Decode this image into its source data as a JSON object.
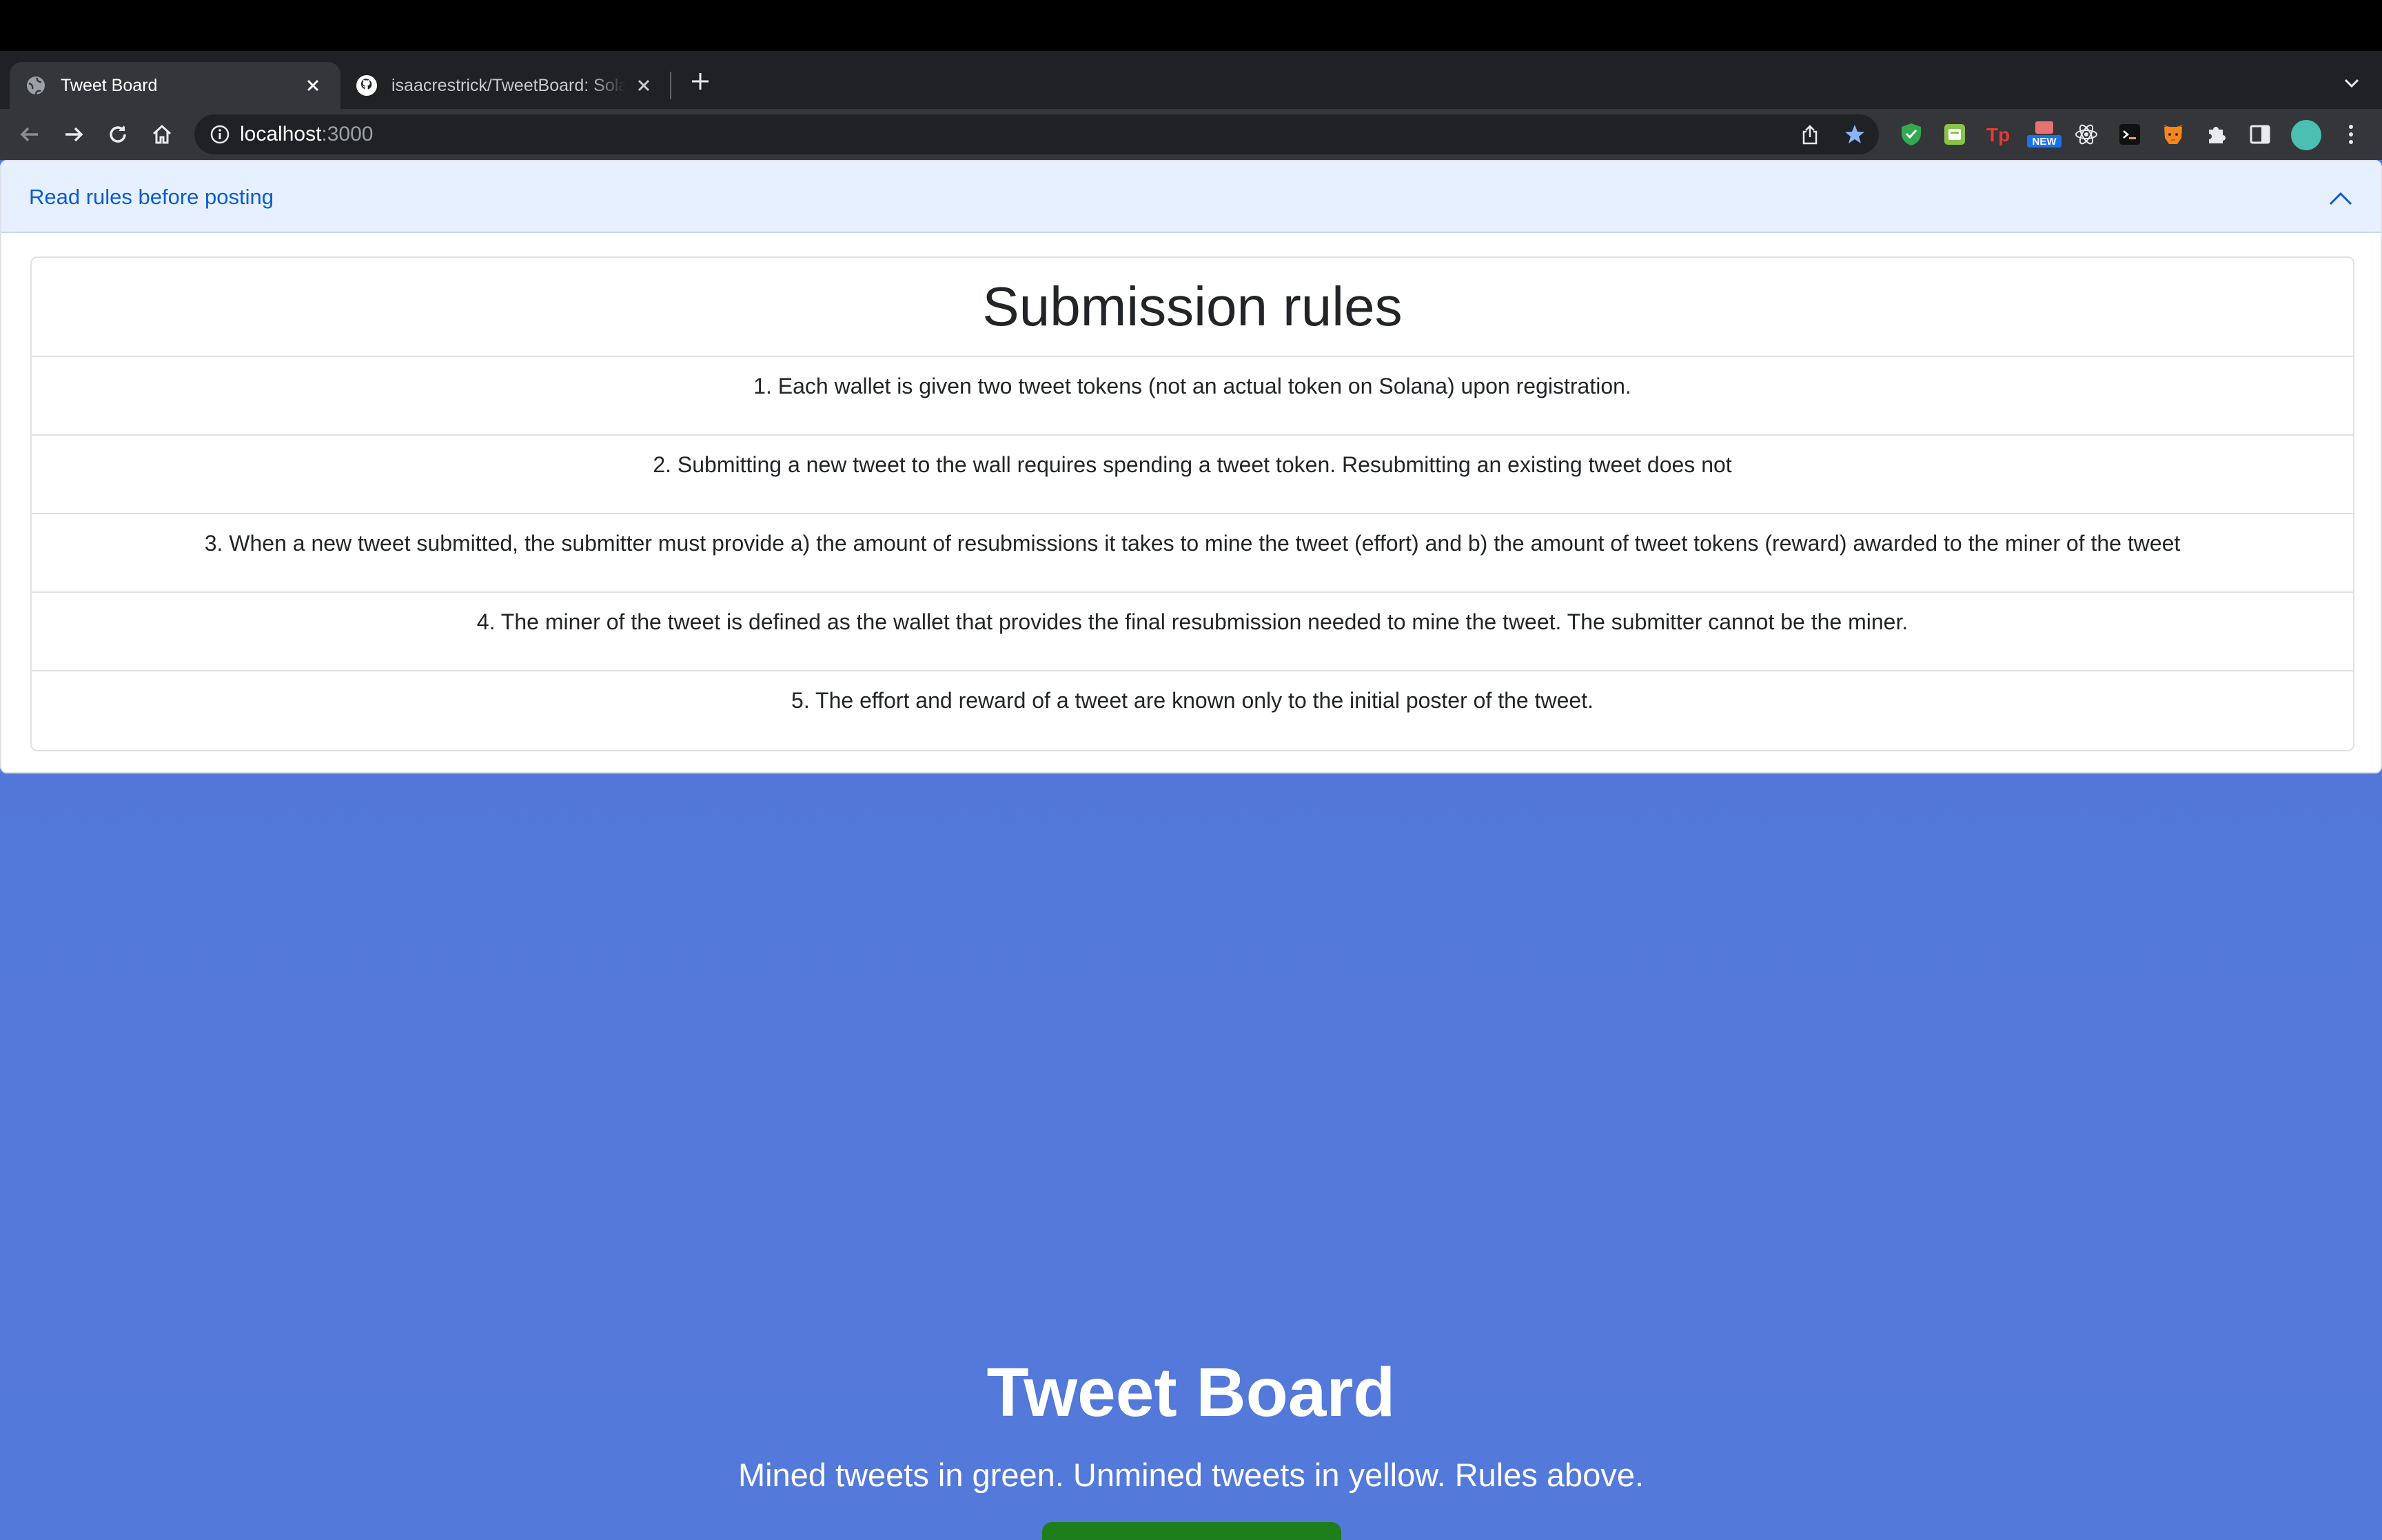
{
  "browser": {
    "tabs": [
      {
        "title": "Tweet Board",
        "active": true,
        "favicon": "globe-icon"
      },
      {
        "title": "isaacrestrick/TweetBoard: Sola",
        "active": false,
        "favicon": "github-icon"
      }
    ],
    "url": {
      "host": "localhost",
      "port": ":3000"
    },
    "extensions": [
      "shield-extension-icon",
      "green-extension-icon",
      "tp-extension-icon",
      "new-badge-extension-icon",
      "react-devtools-icon",
      "terminal-extension-icon",
      "metamask-fox-icon",
      "puzzle-extensions-icon",
      "side-panel-icon"
    ],
    "ext_labels": {
      "tp": "Tp",
      "new": "NEW"
    },
    "avatar_color": "#4bbfb2"
  },
  "accordion": {
    "title": "Read rules before posting",
    "expanded": true
  },
  "rules": {
    "heading": "Submission rules",
    "items": [
      "1. Each wallet is given two tweet tokens (not an actual token on Solana) upon registration.",
      "2. Submitting a new tweet to the wall requires spending a tweet token. Resubmitting an existing tweet does not",
      "3. When a new tweet submitted, the submitter must provide a) the amount of resubmissions it takes to mine the tweet (effort) and b) the amount of tweet tokens (reward) awarded to the miner of the tweet",
      "4. The miner of the tweet is defined as the wallet that provides the final resubmission needed to mine the tweet. The submitter cannot be the miner.",
      "5. The effort and reward of a tweet are known only to the initial poster of the tweet."
    ]
  },
  "hero": {
    "title": "Tweet Board",
    "subtitle": "Mined tweets in green. Unmined tweets in yellow. Rules above."
  },
  "colors": {
    "page_background": "#5277d9",
    "accordion_header": "#e7f0ff",
    "accordion_title": "#0c5bd2",
    "hero_button": "#1e7e1e"
  }
}
